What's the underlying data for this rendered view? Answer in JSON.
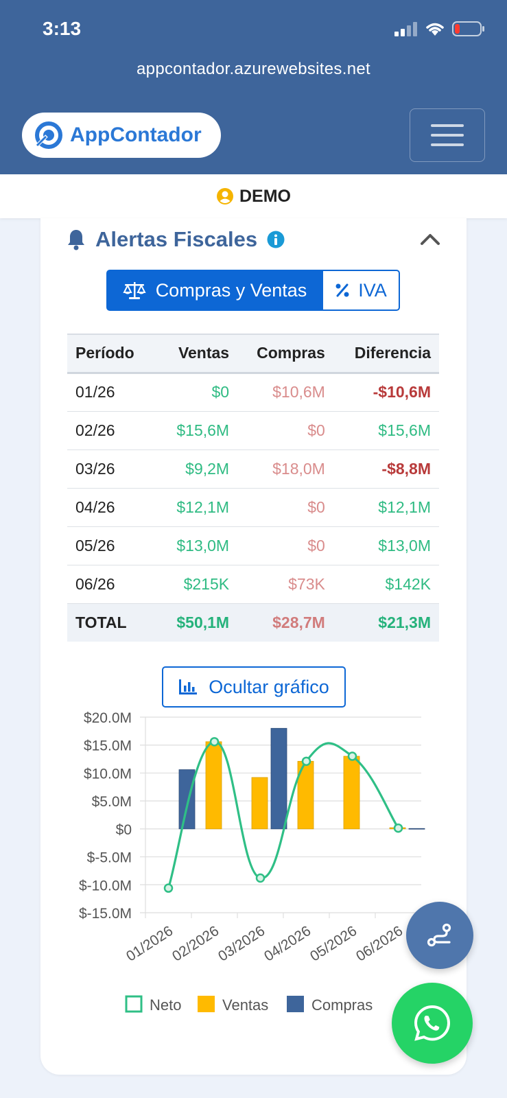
{
  "status_bar": {
    "time": "3:13"
  },
  "browser": {
    "url": "appcontador.azurewebsites.net"
  },
  "header": {
    "brand": "AppContador"
  },
  "user": {
    "name": "DEMO"
  },
  "alerts": {
    "title": "Alertas Fiscales",
    "tabs": [
      {
        "label": "Compras y Ventas",
        "active": true
      },
      {
        "label": "IVA",
        "active": false
      }
    ],
    "table": {
      "headers": [
        "Período",
        "Ventas",
        "Compras",
        "Diferencia"
      ],
      "rows": [
        {
          "periodo": "01/26",
          "ventas": "$0",
          "compras": "$10,6M",
          "diferencia": "-$10,6M"
        },
        {
          "periodo": "02/26",
          "ventas": "$15,6M",
          "compras": "$0",
          "diferencia": "$15,6M"
        },
        {
          "periodo": "03/26",
          "ventas": "$9,2M",
          "compras": "$18,0M",
          "diferencia": "-$8,8M"
        },
        {
          "periodo": "04/26",
          "ventas": "$12,1M",
          "compras": "$0",
          "diferencia": "$12,1M"
        },
        {
          "periodo": "05/26",
          "ventas": "$13,0M",
          "compras": "$0",
          "diferencia": "$13,0M"
        },
        {
          "periodo": "06/26",
          "ventas": "$215K",
          "compras": "$73K",
          "diferencia": "$142K"
        }
      ],
      "total": {
        "label": "TOTAL",
        "ventas": "$50,1M",
        "compras": "$28,7M",
        "diferencia": "$21,3M"
      }
    },
    "chart_toggle_label": "Ocultar gráfico"
  },
  "chart_data": {
    "type": "bar",
    "categories": [
      "01/2026",
      "02/2026",
      "03/2026",
      "04/2026",
      "05/2026",
      "06/2026"
    ],
    "series": [
      {
        "name": "Neto",
        "type": "line",
        "color": "#2fbf86",
        "values": [
          -10.6,
          15.6,
          -8.8,
          12.1,
          13.0,
          0.142
        ]
      },
      {
        "name": "Ventas",
        "type": "bar",
        "color": "#ffba00",
        "values": [
          0,
          15.6,
          9.2,
          12.1,
          13.0,
          0.215
        ]
      },
      {
        "name": "Compras",
        "type": "bar",
        "color": "#3e659b",
        "values": [
          10.6,
          0,
          18.0,
          0,
          0,
          0.073
        ]
      }
    ],
    "ylim": [
      -15,
      20
    ],
    "yticks": [
      "$20.0M",
      "$15.0M",
      "$10.0M",
      "$5.0M",
      "$0",
      "$-5.0M",
      "$-10.0M",
      "$-15.0M"
    ],
    "ytick_values": [
      20,
      15,
      10,
      5,
      0,
      -5,
      -10,
      -15
    ],
    "legend_position": "bottom",
    "grid": true
  }
}
